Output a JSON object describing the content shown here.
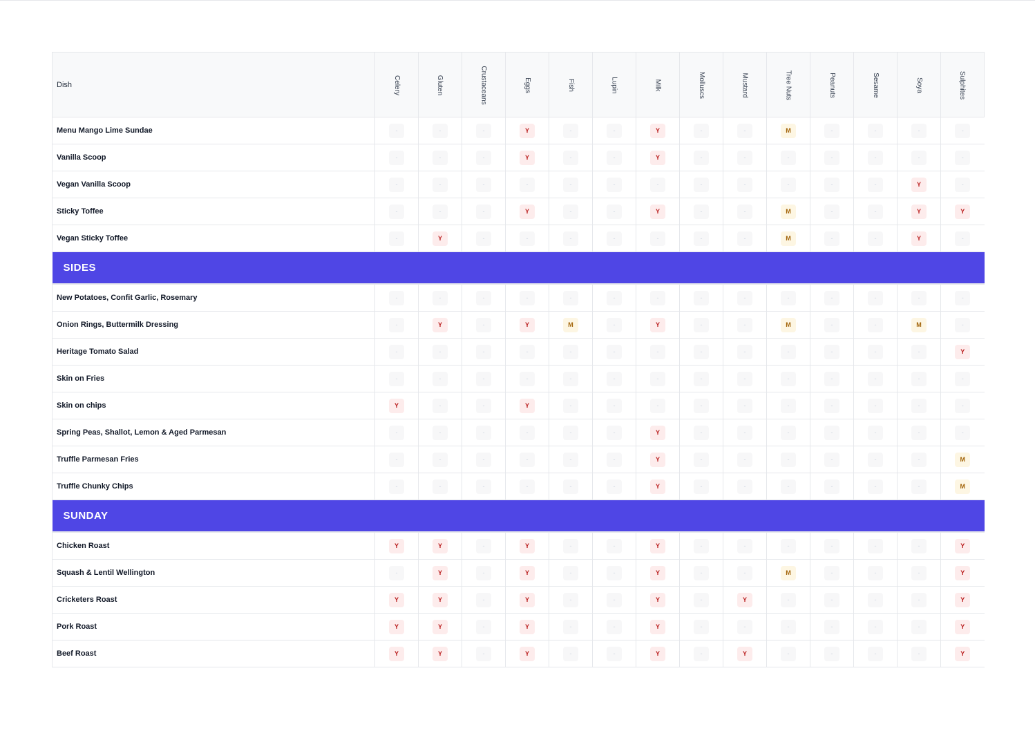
{
  "header": {
    "dish_label": "Dish",
    "allergens": [
      "Celery",
      "Gluten",
      "Crustaceans",
      "Eggs",
      "Fish",
      "Lupin",
      "Milk",
      "Molluscs",
      "Mustard",
      "Tree Nuts",
      "Peanuts",
      "Sesame",
      "Soya",
      "Sulphites"
    ]
  },
  "colors": {
    "section_bg": "#4f46e5",
    "yes_bg": "#fdecec",
    "yes_fg": "#b91c1c",
    "may_bg": "#fdf6e3",
    "may_fg": "#a16207"
  },
  "groups": [
    {
      "title": "",
      "rows": [
        {
          "dish": "Menu Mango Lime Sundae",
          "marks": [
            "-",
            "-",
            "-",
            "Y",
            "-",
            "-",
            "Y",
            "-",
            "-",
            "M",
            "-",
            "-",
            "-",
            "-"
          ]
        },
        {
          "dish": "Vanilla Scoop",
          "marks": [
            "-",
            "-",
            "-",
            "Y",
            "-",
            "-",
            "Y",
            "-",
            "-",
            "-",
            "-",
            "-",
            "-",
            "-"
          ]
        },
        {
          "dish": "Vegan Vanilla Scoop",
          "marks": [
            "-",
            "-",
            "-",
            "-",
            "-",
            "-",
            "-",
            "-",
            "-",
            "-",
            "-",
            "-",
            "Y",
            "-"
          ]
        },
        {
          "dish": "Sticky Toffee",
          "marks": [
            "-",
            "-",
            "-",
            "Y",
            "-",
            "-",
            "Y",
            "-",
            "-",
            "M",
            "-",
            "-",
            "Y",
            "Y"
          ]
        },
        {
          "dish": "Vegan Sticky Toffee",
          "marks": [
            "-",
            "Y",
            "-",
            "-",
            "-",
            "-",
            "-",
            "-",
            "-",
            "M",
            "-",
            "-",
            "Y",
            "-"
          ]
        }
      ]
    },
    {
      "title": "SIDES",
      "rows": [
        {
          "dish": "New Potatoes, Confit Garlic, Rosemary",
          "marks": [
            "-",
            "-",
            "-",
            "-",
            "-",
            "-",
            "-",
            "-",
            "-",
            "-",
            "-",
            "-",
            "-",
            "-"
          ]
        },
        {
          "dish": "Onion Rings, Buttermilk Dressing",
          "marks": [
            "-",
            "Y",
            "-",
            "Y",
            "M",
            "-",
            "Y",
            "-",
            "-",
            "M",
            "-",
            "-",
            "M",
            "-"
          ]
        },
        {
          "dish": "Heritage Tomato Salad",
          "marks": [
            "-",
            "-",
            "-",
            "-",
            "-",
            "-",
            "-",
            "-",
            "-",
            "-",
            "-",
            "-",
            "-",
            "Y"
          ]
        },
        {
          "dish": "Skin on Fries",
          "marks": [
            "-",
            "-",
            "-",
            "-",
            "-",
            "-",
            "-",
            "-",
            "-",
            "-",
            "-",
            "-",
            "-",
            "-"
          ]
        },
        {
          "dish": "Skin on chips",
          "marks": [
            "Y",
            "-",
            "-",
            "Y",
            "-",
            "-",
            "-",
            "-",
            "-",
            "-",
            "-",
            "-",
            "-",
            "-"
          ]
        },
        {
          "dish": "Spring Peas, Shallot, Lemon & Aged Parmesan",
          "marks": [
            "-",
            "-",
            "-",
            "-",
            "-",
            "-",
            "Y",
            "-",
            "-",
            "-",
            "-",
            "-",
            "-",
            "-"
          ]
        },
        {
          "dish": "Truffle Parmesan Fries",
          "marks": [
            "-",
            "-",
            "-",
            "-",
            "-",
            "-",
            "Y",
            "-",
            "-",
            "-",
            "-",
            "-",
            "-",
            "M"
          ]
        },
        {
          "dish": "Truffle Chunky Chips",
          "marks": [
            "-",
            "-",
            "-",
            "-",
            "-",
            "-",
            "Y",
            "-",
            "-",
            "-",
            "-",
            "-",
            "-",
            "M"
          ]
        }
      ]
    },
    {
      "title": "SUNDAY",
      "rows": [
        {
          "dish": "Chicken Roast",
          "marks": [
            "Y",
            "Y",
            "-",
            "Y",
            "-",
            "-",
            "Y",
            "-",
            "-",
            "-",
            "-",
            "-",
            "-",
            "Y"
          ]
        },
        {
          "dish": "Squash & Lentil Wellington",
          "marks": [
            "-",
            "Y",
            "-",
            "Y",
            "-",
            "-",
            "Y",
            "-",
            "-",
            "M",
            "-",
            "-",
            "-",
            "Y"
          ]
        },
        {
          "dish": "Cricketers Roast",
          "marks": [
            "Y",
            "Y",
            "-",
            "Y",
            "-",
            "-",
            "Y",
            "-",
            "Y",
            "-",
            "-",
            "-",
            "-",
            "Y"
          ]
        },
        {
          "dish": "Pork Roast",
          "marks": [
            "Y",
            "Y",
            "-",
            "Y",
            "-",
            "-",
            "Y",
            "-",
            "-",
            "-",
            "-",
            "-",
            "-",
            "Y"
          ]
        },
        {
          "dish": "Beef Roast",
          "marks": [
            "Y",
            "Y",
            "-",
            "Y",
            "-",
            "-",
            "Y",
            "-",
            "Y",
            "-",
            "-",
            "-",
            "-",
            "Y"
          ]
        }
      ]
    }
  ]
}
